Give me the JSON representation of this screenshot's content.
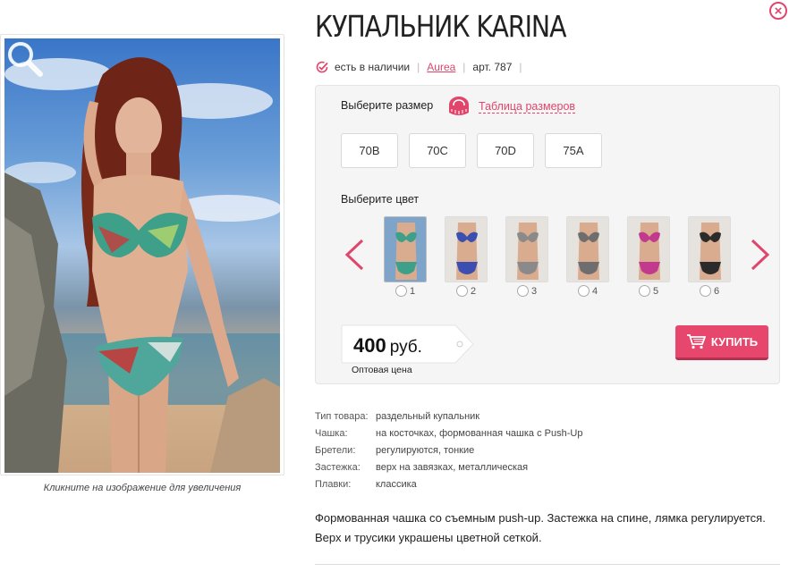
{
  "product": {
    "title": "КУПАЛЬНИК KARINA",
    "availability": "есть в наличии",
    "brand": "Aurea",
    "article": "арт. 787"
  },
  "photo": {
    "caption": "Кликните на изображение для увеличения"
  },
  "options": {
    "size_label": "Выберите размер",
    "size_table_link": "Таблица размеров",
    "sizes": [
      "70B",
      "70C",
      "70D",
      "75A"
    ],
    "color_label": "Выберите цвет",
    "colors": [
      {
        "num": "1",
        "hex": "#3fa08a"
      },
      {
        "num": "2",
        "hex": "#3a4fb0"
      },
      {
        "num": "3",
        "hex": "#8a8a8a"
      },
      {
        "num": "4",
        "hex": "#6e6e6e"
      },
      {
        "num": "5",
        "hex": "#c23a8e"
      },
      {
        "num": "6",
        "hex": "#2b2b2b"
      }
    ]
  },
  "price": {
    "amount": "400",
    "currency": "руб.",
    "note": "Оптовая цена"
  },
  "buy_button": {
    "label": "КУПИТЬ"
  },
  "specs": [
    {
      "key": "Тип товара:",
      "value": "раздельный купальник"
    },
    {
      "key": "Чашка:",
      "value": "на косточках, формованная чашка с Push-Up"
    },
    {
      "key": "Бретели:",
      "value": "регулируются, тонкие"
    },
    {
      "key": "Застежка:",
      "value": "верх на завязках, металлическая"
    },
    {
      "key": "Плавки:",
      "value": "классика"
    }
  ],
  "description": "Формованная чашка со съемным push-up. Застежка на спине, лямка регулируется. Верх и трусики украшены цветной сеткой.",
  "theme": {
    "accent": "#e0466c",
    "panel_bg": "#f5f5f5"
  }
}
